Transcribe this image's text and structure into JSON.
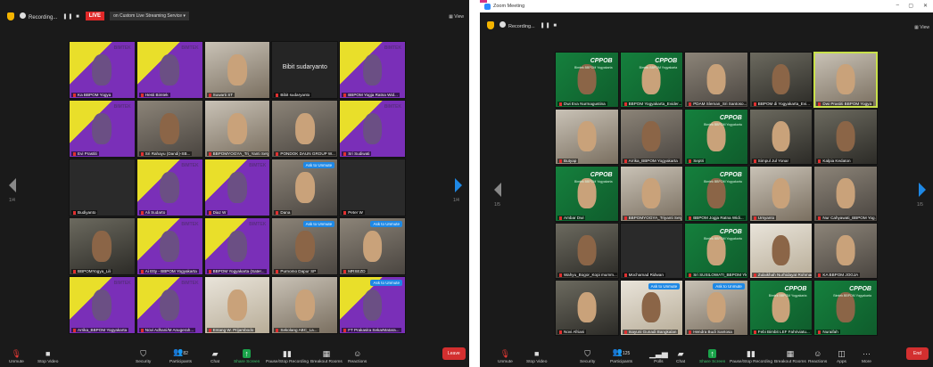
{
  "left": {
    "recording_label": "Recording...",
    "live_badge": "LIVE",
    "stream_service": "on Custom Live Streaming Service",
    "view_label": "View",
    "page_left": "1/4",
    "page_right": "1/4",
    "bibit_big": "Bibit sudaryanto",
    "tiles": [
      {
        "name": "Ka BBPOM Yogya",
        "style": "purple"
      },
      {
        "name": "Hesti Bimtek",
        "style": "purple"
      },
      {
        "name": "Suwarti ST",
        "style": "cam2"
      },
      {
        "name": "Bibit sudaryanto",
        "style": "bibit"
      },
      {
        "name": "BBPOM Yogja Ratna Wid...",
        "style": "purple"
      },
      {
        "name": "Evi Prastiti",
        "style": "purple"
      },
      {
        "name": "Sri Rahayu (Dandi)-SB...",
        "style": "cam"
      },
      {
        "name": "BBPOMYOGYA_Tri_Yanti Setya...",
        "style": "cam2"
      },
      {
        "name": "PONDOK DAUN GROUP W...",
        "style": "cam"
      },
      {
        "name": "Sri Sudiwati",
        "style": "purple"
      },
      {
        "name": "Budiyanto",
        "style": "dark"
      },
      {
        "name": "Ali Sudarto",
        "style": "purple"
      },
      {
        "name": "Diaz W",
        "style": "purple"
      },
      {
        "name": "Dana",
        "style": "cam",
        "unmute": true
      },
      {
        "name": "Peter W",
        "style": "dark"
      },
      {
        "name": "BBPOMYogya_Lili",
        "style": "cam3"
      },
      {
        "name": "Ai Etty - BBPOM Yogyakarta",
        "style": "purple"
      },
      {
        "name": "BBPOM Yogyakarta (Sater...",
        "style": "purple"
      },
      {
        "name": "Purnomo Dapur SP",
        "style": "cam",
        "unmute": true
      },
      {
        "name": "MRSEZD",
        "style": "cam",
        "unmute": true
      },
      {
        "name": "Arrika_BBPOM Yogyakarta",
        "style": "purple"
      },
      {
        "name": "Novi Adhani/M Anugerah...",
        "style": "purple"
      },
      {
        "name": "Entang W. Prijambodo",
        "style": "light"
      },
      {
        "name": "Sekolang ABC_La...",
        "style": "cam2"
      },
      {
        "name": "FT Prakasita SekarMatara...",
        "style": "purple",
        "unmute": true
      }
    ],
    "unmute_label": "Ask to Unmute",
    "bimtek_label": "BIMTEK",
    "toolbar": {
      "unmute": "Unmute",
      "stop_video": "Stop Video",
      "security": "Security",
      "participants": "Participants",
      "participants_count": "82",
      "chat": "Chat",
      "share_screen": "Share Screen",
      "pause_recording": "Pause/Stop Recording",
      "breakout": "Breakout Rooms",
      "reactions": "Reactions",
      "leave": "Leave"
    }
  },
  "right": {
    "window_title": "Zoom Meeting",
    "recording_label": "Recording...",
    "view_label": "View",
    "page_left": "1/5",
    "page_right": "1/5",
    "cppob_label": "CPPOB",
    "cppob_sub": "Bimtek BBPOM Yogyakarta",
    "unmute_label": "Ask to Unmute",
    "tiles": [
      {
        "name": "Dwi Eva Nurmagustina",
        "style": "green"
      },
      {
        "name": "BBPOM Yogyakarta_Evider...",
        "style": "green"
      },
      {
        "name": "PDAM Sleman_Sri Santoso...",
        "style": "cam"
      },
      {
        "name": "BBPOM di Yogyakarta_Evi...",
        "style": "cam3"
      },
      {
        "name": "Dwi Prastiti BBPOM Yogya",
        "style": "cam2",
        "speaking": true
      },
      {
        "name": "Butyap",
        "style": "cam2"
      },
      {
        "name": "Arrika_BBPOM Yogyakarta",
        "style": "cam"
      },
      {
        "name": "Septri",
        "style": "green"
      },
      {
        "name": "Simpul Jul Yonar",
        "style": "cam3"
      },
      {
        "name": "Kalpia Kedaton",
        "style": "cam3"
      },
      {
        "name": "Ambar Dwi",
        "style": "green"
      },
      {
        "name": "BBPOMYOGYA_Triyanti Setya...",
        "style": "cam2"
      },
      {
        "name": "BBPOM Jogja Ratna Widi...",
        "style": "green"
      },
      {
        "name": "Ursyanto",
        "style": "cam2"
      },
      {
        "name": "Nur Cahyawati_BBPOM Yog...",
        "style": "cam"
      },
      {
        "name": "Wahyu_Bogor_Kopi mumm...",
        "style": "cam3"
      },
      {
        "name": "Mochamad Ridwan",
        "style": "dark"
      },
      {
        "name": "Sri SUSILOWATI_BBPOM Yk",
        "style": "green"
      },
      {
        "name": "Zulaikhah Nurhidayat Rohmar...",
        "style": "light"
      },
      {
        "name": "KA BBPOM JOGJA",
        "style": "cam"
      },
      {
        "name": "Novi Afriani",
        "style": "cam3"
      },
      {
        "name": "Inayuni Gunadi Bangkalan",
        "style": "light",
        "unmute": true
      },
      {
        "name": "Hendra Budi Santosa",
        "style": "cam2",
        "unmute": true
      },
      {
        "name": "Febi Bimbit LEF Fahriviatu...",
        "style": "green"
      },
      {
        "name": "Nuraifah",
        "style": "green"
      }
    ],
    "toolbar": {
      "unmute": "Unmute",
      "stop_video": "Stop Video",
      "security": "Security",
      "participants": "Participants",
      "participants_count": "125",
      "polls": "Polls",
      "chat": "Chat",
      "share_screen": "Share Screen",
      "pause_recording": "Pause/Stop Recording",
      "breakout": "Breakout Rooms",
      "reactions": "Reactions",
      "apps": "Apps",
      "more": "More",
      "end": "End"
    }
  }
}
